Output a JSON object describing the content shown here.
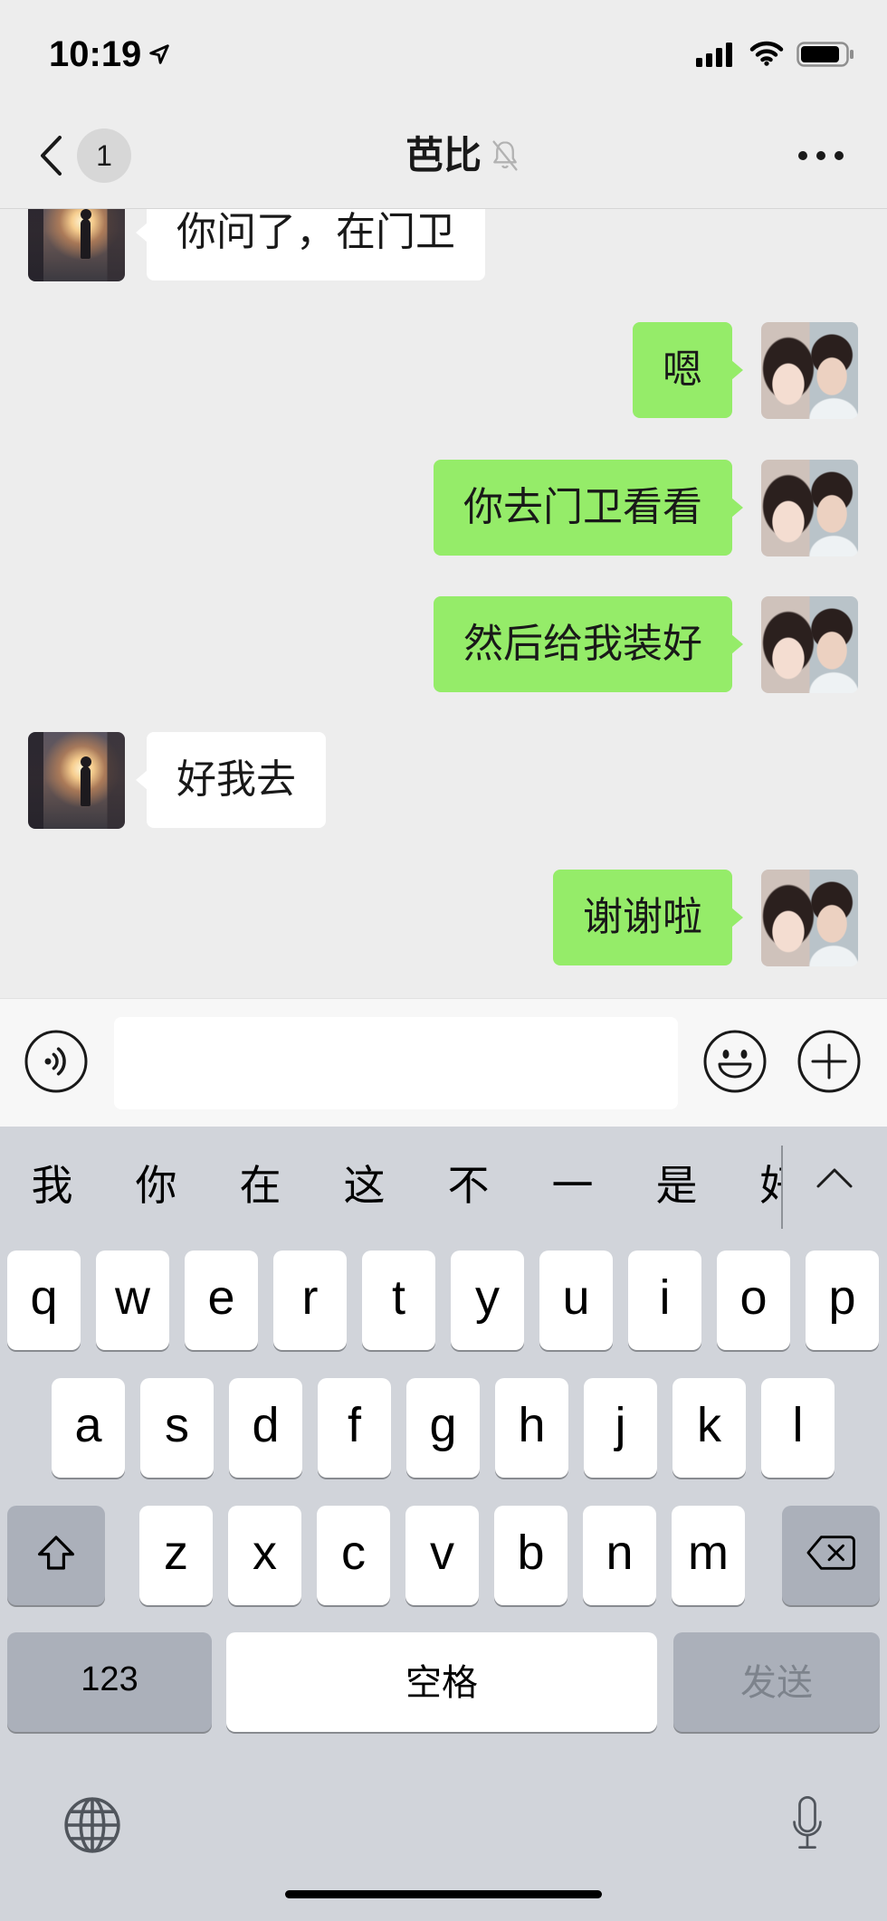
{
  "status_bar": {
    "time": "10:19",
    "icons": [
      "location-arrow-icon",
      "signal-icon",
      "wifi-icon",
      "battery-icon"
    ]
  },
  "nav": {
    "back_badge": "1",
    "title": "芭比",
    "icons": {
      "back": "chevron-left-icon",
      "mute": "bell-muted-icon",
      "more": "more-dots-icon"
    }
  },
  "messages": [
    {
      "outgoing": false,
      "text": "你问了，在门卫"
    },
    {
      "outgoing": true,
      "text": "嗯"
    },
    {
      "outgoing": true,
      "text": "你去门卫看看"
    },
    {
      "outgoing": true,
      "text": "然后给我装好"
    },
    {
      "outgoing": false,
      "text": "好我去"
    },
    {
      "outgoing": true,
      "text": "谢谢啦"
    }
  ],
  "input_bar": {
    "value": "",
    "icons": {
      "voice": "voice-input-icon",
      "emoji": "emoji-icon",
      "more": "plus-circle-icon"
    }
  },
  "keyboard": {
    "candidates": [
      "我",
      "你",
      "在",
      "这",
      "不",
      "一",
      "是",
      "好"
    ],
    "rows": [
      [
        "q",
        "w",
        "e",
        "r",
        "t",
        "y",
        "u",
        "i",
        "o",
        "p"
      ],
      [
        "a",
        "s",
        "d",
        "f",
        "g",
        "h",
        "j",
        "k",
        "l"
      ],
      [
        "z",
        "x",
        "c",
        "v",
        "b",
        "n",
        "m"
      ]
    ],
    "numbers_label": "123",
    "space_label": "空格",
    "send_label": "发送",
    "icons": {
      "collapse": "chevron-up-icon",
      "shift": "shift-icon",
      "delete": "backspace-icon",
      "globe": "globe-icon",
      "dictation": "microphone-icon"
    }
  },
  "colors": {
    "chat_background": "#EDEDED",
    "outgoing_bubble": "#95EC69",
    "incoming_bubble": "#FFFFFF",
    "input_bar_background": "#F7F7F7",
    "keyboard_background": "#D1D4DA",
    "key": "#FFFFFF",
    "special_key": "#ABB0BA"
  }
}
